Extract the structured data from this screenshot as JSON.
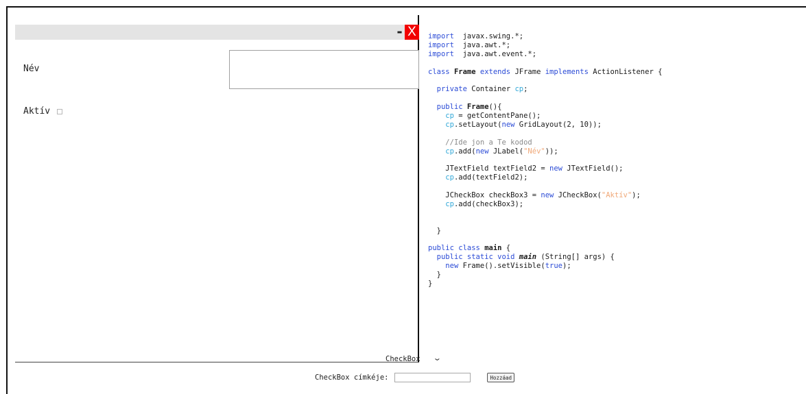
{
  "frame": {
    "minimize_label": "-",
    "close_label": "X",
    "name_label": "Név",
    "name_value": "",
    "active_label": "Aktív",
    "active_checked": false
  },
  "code": {
    "lines": [
      [
        [
          "kw",
          "import"
        ],
        [
          "",
          "  javax.swing.*;"
        ]
      ],
      [
        [
          "kw",
          "import"
        ],
        [
          "",
          "  java.awt.*;"
        ]
      ],
      [
        [
          "kw",
          "import"
        ],
        [
          "",
          "  java.awt.event.*;"
        ]
      ],
      [],
      [
        [
          "kw",
          "class"
        ],
        [
          "",
          " "
        ],
        [
          "b",
          "Frame"
        ],
        [
          "",
          " "
        ],
        [
          "kw",
          "extends"
        ],
        [
          "",
          " JFrame "
        ],
        [
          "kw",
          "implements"
        ],
        [
          "",
          " ActionListener {"
        ]
      ],
      [],
      [
        [
          "",
          "  "
        ],
        [
          "kw",
          "private"
        ],
        [
          "",
          " Container "
        ],
        [
          "cp",
          "cp"
        ],
        [
          "",
          ";"
        ]
      ],
      [],
      [
        [
          "",
          "  "
        ],
        [
          "kw",
          "public"
        ],
        [
          "",
          " "
        ],
        [
          "b",
          "Frame"
        ],
        [
          "",
          "(){"
        ]
      ],
      [
        [
          "",
          "    "
        ],
        [
          "cp",
          "cp"
        ],
        [
          "",
          " = getContentPane();"
        ]
      ],
      [
        [
          "",
          "    "
        ],
        [
          "cp",
          "cp"
        ],
        [
          "",
          ".setLayout("
        ],
        [
          "kw",
          "new"
        ],
        [
          "",
          " GridLayout(2, 10));"
        ]
      ],
      [],
      [
        [
          "",
          "    "
        ],
        [
          "cm",
          "//Ide jon a Te kodod"
        ]
      ],
      [
        [
          "",
          "    "
        ],
        [
          "cp",
          "cp"
        ],
        [
          "",
          ".add("
        ],
        [
          "kw",
          "new"
        ],
        [
          "",
          " JLabel("
        ],
        [
          "str",
          "\"Név\""
        ],
        [
          "",
          "));"
        ]
      ],
      [],
      [
        [
          "",
          "    JTextField textField2 = "
        ],
        [
          "kw",
          "new"
        ],
        [
          "",
          " JTextField();"
        ]
      ],
      [
        [
          "",
          "    "
        ],
        [
          "cp",
          "cp"
        ],
        [
          "",
          ".add(textField2);"
        ]
      ],
      [],
      [
        [
          "",
          "    JCheckBox checkBox3 = "
        ],
        [
          "kw",
          "new"
        ],
        [
          "",
          " JCheckBox("
        ],
        [
          "str",
          "\"Aktív\""
        ],
        [
          "",
          ");"
        ]
      ],
      [
        [
          "",
          "    "
        ],
        [
          "cp",
          "cp"
        ],
        [
          "",
          ".add(checkBox3);"
        ]
      ],
      [],
      [],
      [
        [
          "",
          "  }"
        ]
      ],
      [],
      [
        [
          "kw",
          "public class"
        ],
        [
          "",
          " "
        ],
        [
          "b",
          "main"
        ],
        [
          "",
          " {"
        ]
      ],
      [
        [
          "",
          "  "
        ],
        [
          "kw",
          "public static void"
        ],
        [
          "",
          " "
        ],
        [
          "bi",
          "main"
        ],
        [
          "",
          " (String[] args) {"
        ]
      ],
      [
        [
          "",
          "    "
        ],
        [
          "kw",
          "new"
        ],
        [
          "",
          " Frame().setVisible("
        ],
        [
          "kw",
          "true"
        ],
        [
          "",
          ");"
        ]
      ],
      [
        [
          "",
          "  }"
        ]
      ],
      [
        [
          "",
          "}"
        ]
      ]
    ]
  },
  "controls": {
    "type_select_value": "CheckBox",
    "label_prompt": "CheckBox címkéje:",
    "label_value": "",
    "add_button_label": "Hozzáad"
  },
  "colors": {
    "keyword": "#2b4bd6",
    "field": "#32a8d8",
    "string": "#f0a878",
    "comment": "#8a8a8a",
    "close_button": "#f20000"
  }
}
